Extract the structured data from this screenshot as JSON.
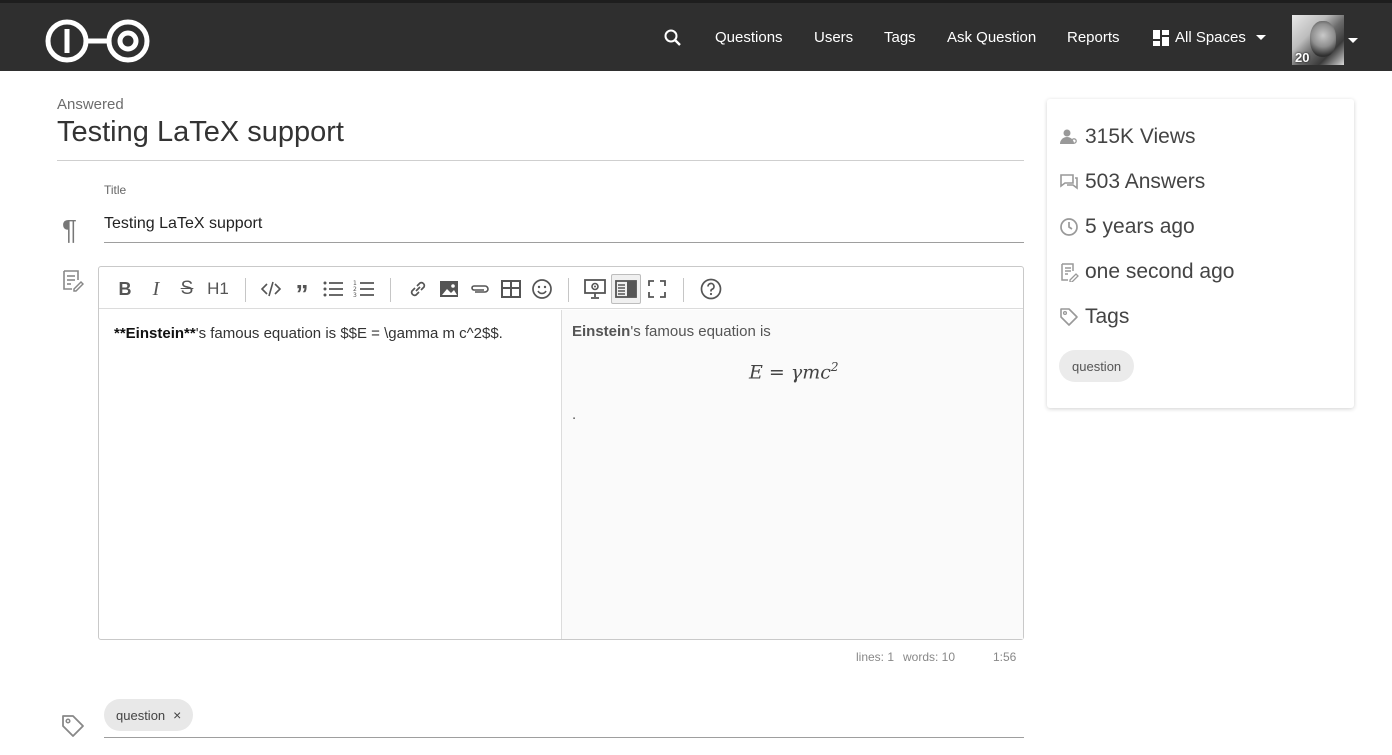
{
  "nav": {
    "links": [
      "Questions",
      "Users",
      "Tags",
      "Ask Question",
      "Reports"
    ],
    "spaces_label": "All Spaces",
    "avatar_rep": "20"
  },
  "header": {
    "status": "Answered",
    "title": "Testing LaTeX support"
  },
  "form": {
    "title_label": "Title",
    "title_value": "Testing LaTeX support"
  },
  "editor": {
    "source_bold": "**Einstein**",
    "source_rest": "'s famous equation is $$E = \\gamma m c^2$$.",
    "preview_bold": "Einstein",
    "preview_rest": "'s famous equation is",
    "preview_math": "E = γmc",
    "preview_math_exp": "2",
    "preview_after": ".",
    "status_lines": "lines: 1",
    "status_words": "words: 10",
    "status_cursor": "1:56"
  },
  "tags_field": {
    "chips": [
      "question"
    ]
  },
  "sidebar": {
    "views": "315K Views",
    "answers": "503 Answers",
    "asked": "5 years ago",
    "edited": "one second ago",
    "tags_heading": "Tags",
    "tags": [
      "question"
    ]
  }
}
